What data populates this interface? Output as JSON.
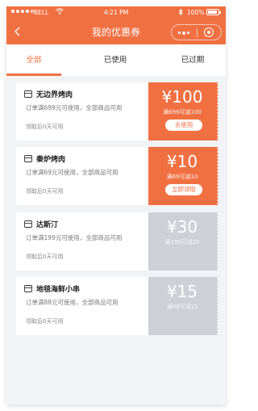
{
  "status_bar": {
    "carrier": "BELL",
    "time": "4:21 PM",
    "battery": "100%"
  },
  "nav": {
    "title": "我的优惠券"
  },
  "tabs": [
    {
      "label": "全部",
      "active": true
    },
    {
      "label": "已使用",
      "active": false
    },
    {
      "label": "已过期",
      "active": false
    }
  ],
  "coupons": [
    {
      "store": "无边界烤肉",
      "condition": "订单满699元可使用，全部商品可用",
      "validity": "领取后0天可用",
      "amount": "¥100",
      "rule": "满699可减100",
      "action": "去使用",
      "state": "active"
    },
    {
      "store": "秦炉烤肉",
      "condition": "订单满69元可使用，全部商品可用",
      "validity": "领取后0天可用",
      "amount": "¥10",
      "rule": "满69可减10",
      "action": "立即领取",
      "state": "active"
    },
    {
      "store": "达斯汀",
      "condition": "订单满199元可使用，全部商品可用",
      "validity": "领取后0天可用",
      "amount": "¥30",
      "rule": "满199可减30",
      "state": "inactive"
    },
    {
      "store": "地毯海鲜小串",
      "condition": "订单满88元可使用，全部商品可用",
      "validity": "领取后0天可用",
      "amount": "¥15",
      "rule": "满88可减15",
      "state": "inactive"
    }
  ],
  "colors": {
    "accent": "#f17042",
    "inactive": "#ced0d6",
    "background": "#f2f3f7"
  }
}
